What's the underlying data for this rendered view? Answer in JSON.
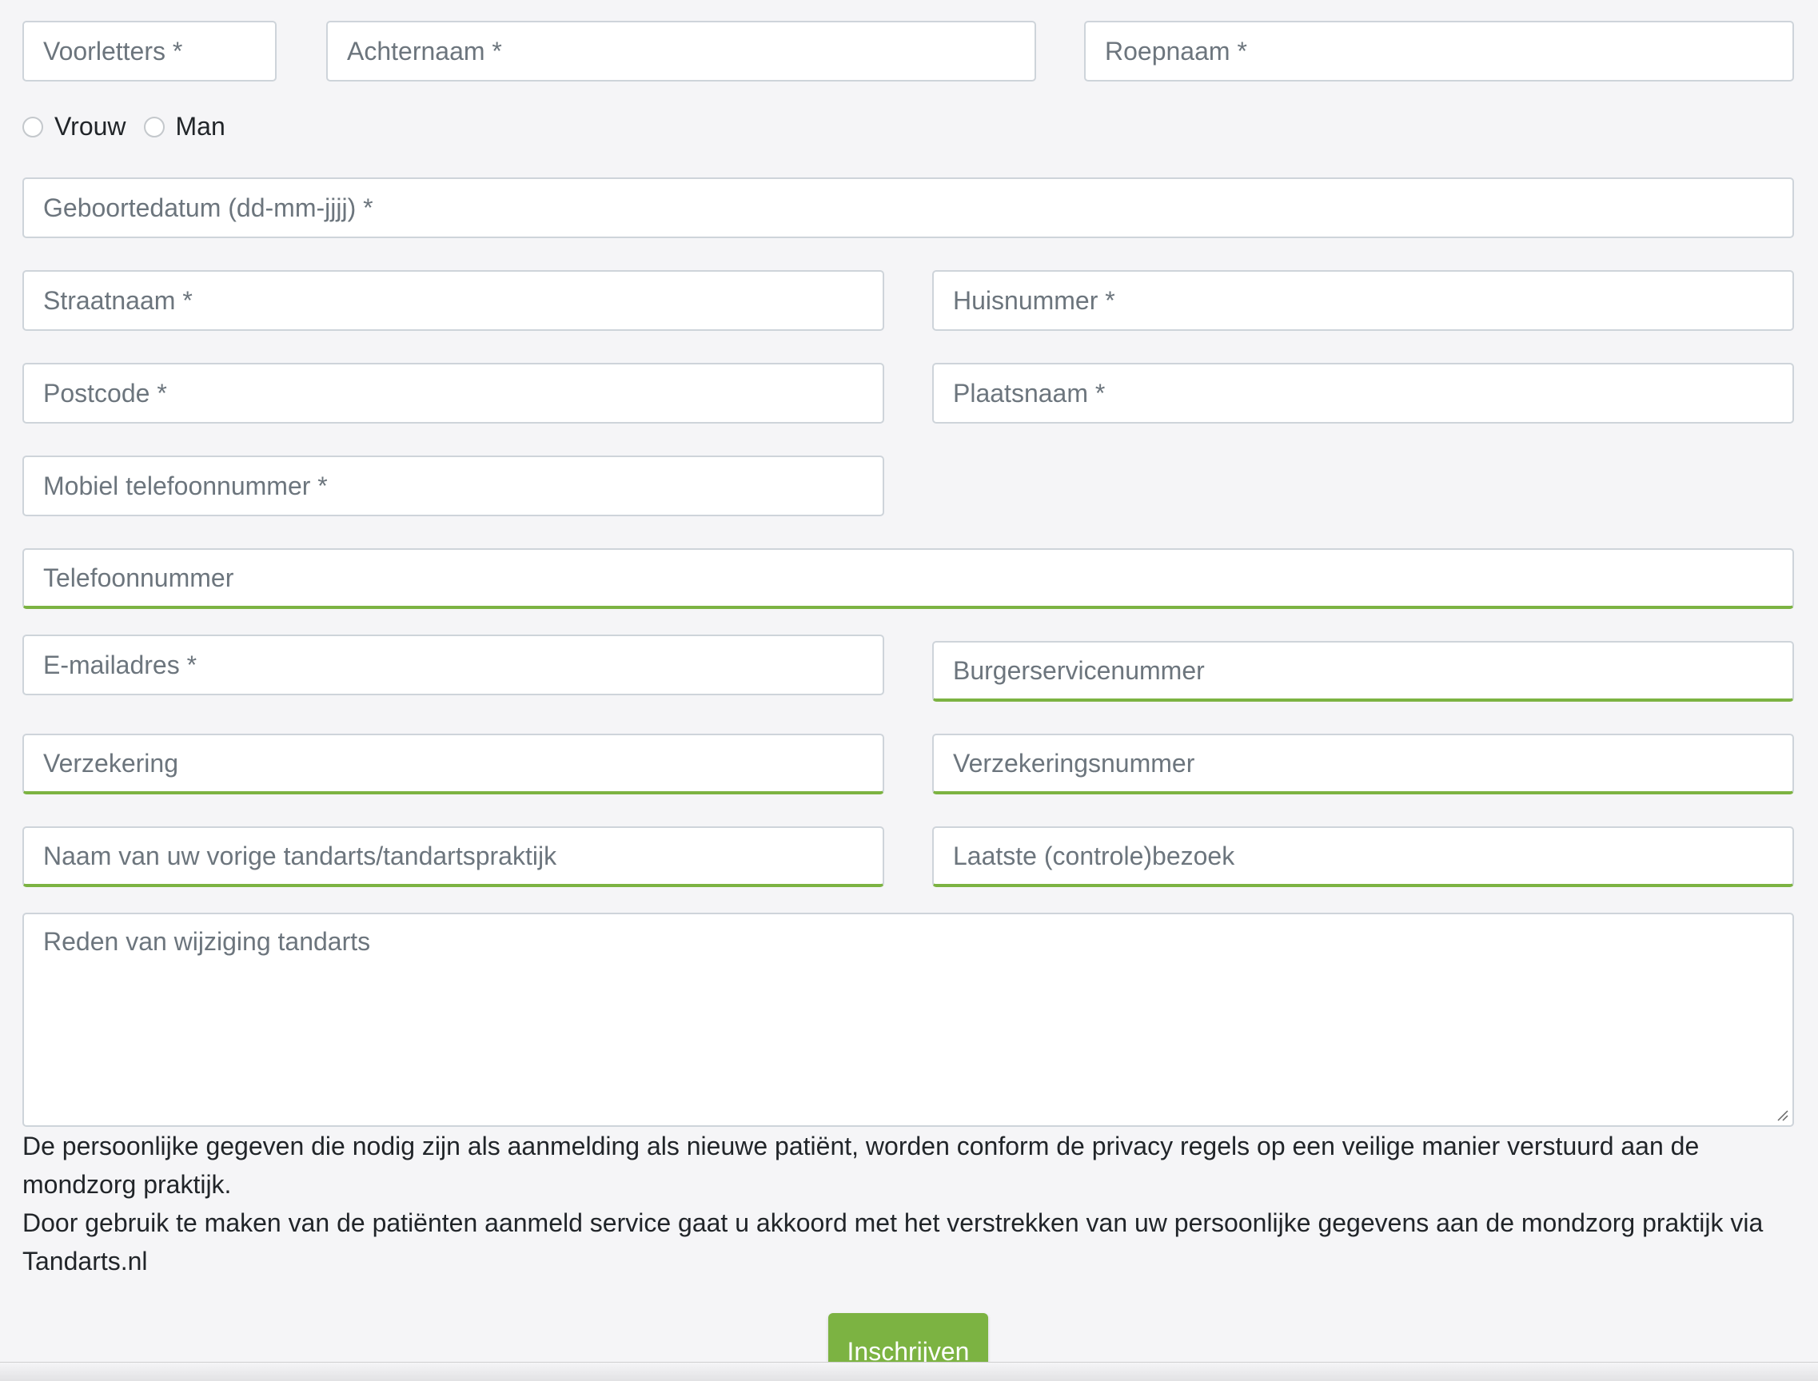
{
  "form": {
    "initials_placeholder": "Voorletters *",
    "lastname_placeholder": "Achternaam *",
    "callname_placeholder": "Roepnaam *",
    "gender": {
      "female_label": "Vrouw",
      "male_label": "Man"
    },
    "birthdate_placeholder": "Geboortedatum (dd-mm-jjjj) *",
    "street_placeholder": "Straatnaam *",
    "housenumber_placeholder": "Huisnummer *",
    "postcode_placeholder": "Postcode *",
    "city_placeholder": "Plaatsnaam *",
    "mobile_placeholder": "Mobiel telefoonnummer *",
    "phone_placeholder": "Telefoonnummer",
    "email_placeholder": "E-mailadres *",
    "bsn_placeholder": "Burgerservicenummer",
    "insurance_placeholder": "Verzekering",
    "insurance_number_placeholder": "Verzekeringsnummer",
    "previous_dentist_placeholder": "Naam van uw vorige tandarts/tandartspraktijk",
    "last_visit_placeholder": "Laatste (controle)bezoek",
    "reason_placeholder": "Reden van wijziging tandarts"
  },
  "notice": {
    "line1": "De persoonlijke gegeven die nodig zijn als aanmelding als nieuwe patiënt, worden conform de privacy regels op een veilige manier verstuurd aan de mondzorg praktijk.",
    "line2": "Door gebruik te maken van de patiënten aanmeld service gaat u akkoord met het verstrekken van uw persoonlijke gegevens aan de mondzorg praktijk via Tandarts.nl"
  },
  "submit_label": "Inschrijven",
  "colors": {
    "accent": "#7cb342",
    "border": "#ced4da",
    "placeholder": "#6c757d",
    "background": "#f5f5f7"
  }
}
